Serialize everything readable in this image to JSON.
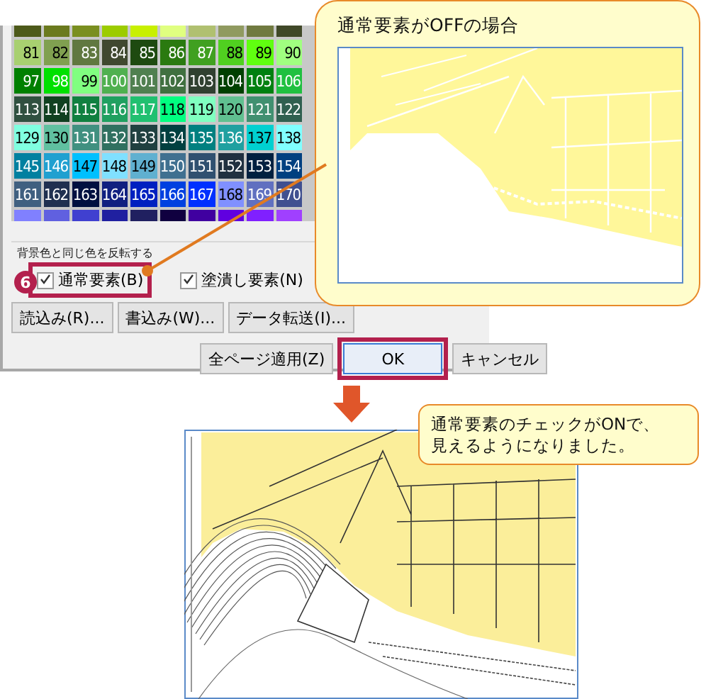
{
  "dialog": {
    "color_grid": {
      "rows": [
        {
          "cells": [
            {
              "color": "#4d5a1a"
            },
            {
              "color": "#6b7a1e"
            },
            {
              "color": "#7a8f20"
            },
            {
              "color": "#9ccc00"
            },
            {
              "color": "#c8f000"
            },
            {
              "color": "#e0ff80"
            },
            {
              "color": "#b0c070"
            },
            {
              "color": "#909a60"
            },
            {
              "color": "#707a40"
            },
            {
              "color": "#404828"
            }
          ]
        },
        {
          "cells": [
            {
              "label": "81",
              "color": "#a8d070"
            },
            {
              "label": "82",
              "color": "#80a050"
            },
            {
              "label": "83",
              "color": "#607840"
            },
            {
              "label": "84",
              "color": "#404830"
            },
            {
              "label": "85",
              "color": "#1e4a10"
            },
            {
              "label": "86",
              "color": "#2a7a10"
            },
            {
              "label": "87",
              "color": "#40a020"
            },
            {
              "label": "88",
              "color": "#50d020"
            },
            {
              "label": "89",
              "color": "#60ff10"
            },
            {
              "label": "90",
              "color": "#a0ff80"
            }
          ]
        },
        {
          "cells": [
            {
              "label": "97",
              "color": "#008000"
            },
            {
              "label": "98",
              "color": "#00e000"
            },
            {
              "label": "99",
              "color": "#80ff80"
            },
            {
              "label": "100",
              "color": "#50b050"
            },
            {
              "label": "101",
              "color": "#508050"
            },
            {
              "label": "102",
              "color": "#407040"
            },
            {
              "label": "103",
              "color": "#304030"
            },
            {
              "label": "104",
              "color": "#004000"
            },
            {
              "label": "105",
              "color": "#008010"
            },
            {
              "label": "106",
              "color": "#20c040"
            }
          ]
        },
        {
          "cells": [
            {
              "label": "113",
              "color": "#305040"
            },
            {
              "label": "114",
              "color": "#104020"
            },
            {
              "label": "115",
              "color": "#108040"
            },
            {
              "label": "116",
              "color": "#20a060"
            },
            {
              "label": "117",
              "color": "#20c070"
            },
            {
              "label": "118",
              "color": "#00ff80"
            },
            {
              "label": "119",
              "color": "#80ffc0"
            },
            {
              "label": "120",
              "color": "#60c090"
            },
            {
              "label": "121",
              "color": "#409070"
            },
            {
              "label": "122",
              "color": "#306050"
            }
          ]
        },
        {
          "cells": [
            {
              "label": "129",
              "color": "#80ffe0"
            },
            {
              "label": "130",
              "color": "#60c0a0"
            },
            {
              "label": "131",
              "color": "#409080"
            },
            {
              "label": "132",
              "color": "#307060"
            },
            {
              "label": "133",
              "color": "#204040"
            },
            {
              "label": "134",
              "color": "#004040"
            },
            {
              "label": "135",
              "color": "#008080"
            },
            {
              "label": "136",
              "color": "#20a0a0"
            },
            {
              "label": "137",
              "color": "#00d0d0"
            },
            {
              "label": "138",
              "color": "#80ffff"
            }
          ]
        },
        {
          "cells": [
            {
              "label": "145",
              "color": "#0080a0"
            },
            {
              "label": "146",
              "color": "#20a0d0"
            },
            {
              "label": "147",
              "color": "#00c0ff"
            },
            {
              "label": "148",
              "color": "#80e0ff"
            },
            {
              "label": "149",
              "color": "#60b0d0"
            },
            {
              "label": "150",
              "color": "#407090"
            },
            {
              "label": "151",
              "color": "#305070"
            },
            {
              "label": "152",
              "color": "#203040"
            },
            {
              "label": "153",
              "color": "#002040"
            },
            {
              "label": "154",
              "color": "#004080"
            }
          ]
        },
        {
          "cells": [
            {
              "label": "161",
              "color": "#406080"
            },
            {
              "label": "162",
              "color": "#203050"
            },
            {
              "label": "163",
              "color": "#001040"
            },
            {
              "label": "164",
              "color": "#102080"
            },
            {
              "label": "165",
              "color": "#0020c0"
            },
            {
              "label": "166",
              "color": "#0040e0"
            },
            {
              "label": "167",
              "color": "#0030ff"
            },
            {
              "label": "168",
              "color": "#8090ff"
            },
            {
              "label": "169",
              "color": "#6070c0"
            },
            {
              "label": "170",
              "color": "#405090"
            }
          ]
        },
        {
          "cells": [
            {
              "color": "#8080ff"
            },
            {
              "color": "#6060e0"
            },
            {
              "color": "#4040d0"
            },
            {
              "color": "#2020a0"
            },
            {
              "color": "#202060"
            },
            {
              "color": "#100040"
            },
            {
              "color": "#4000a0"
            },
            {
              "color": "#6000e0"
            },
            {
              "color": "#8020ff"
            },
            {
              "color": "#a040ff"
            }
          ]
        }
      ]
    },
    "group_label": "背景色と同じ色を反転する",
    "checkboxes": [
      {
        "label": "通常要素(B)",
        "checked": true,
        "highlighted": true,
        "badge": "6"
      },
      {
        "label": "塗潰し要素(N)",
        "checked": true,
        "highlighted": false
      }
    ],
    "file_buttons": [
      {
        "label": "読込み(R)..."
      },
      {
        "label": "書込み(W)..."
      },
      {
        "label": "データ転送(I)..."
      }
    ],
    "action_buttons": [
      {
        "label": "全ページ適用(Z)",
        "default": false,
        "highlighted": false
      },
      {
        "label": "OK",
        "default": true,
        "highlighted": true
      },
      {
        "label": "キャンセル",
        "default": false,
        "highlighted": false
      }
    ]
  },
  "callout_off": {
    "title": "通常要素がOFFの場合"
  },
  "callout_on": {
    "text": "通常要素のチェックがONで、見えるようになりました。"
  }
}
